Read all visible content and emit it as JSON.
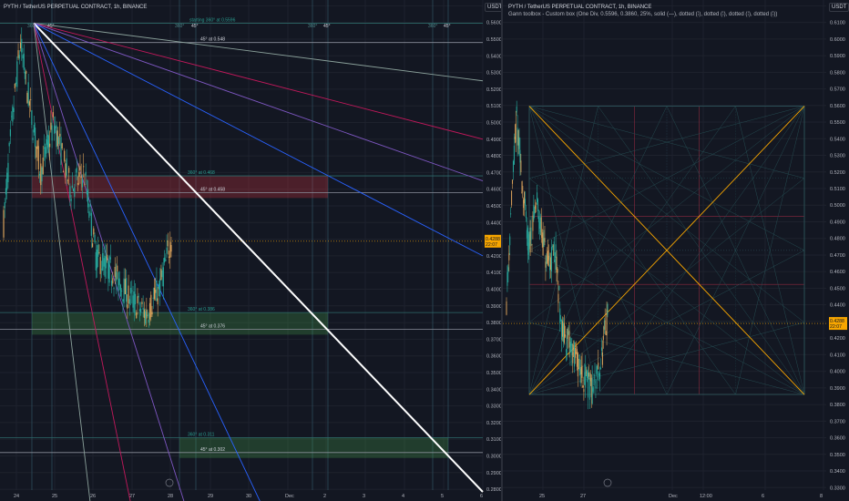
{
  "left": {
    "title": "PYTH / TetherUS PERPETUAL CONTRACT, 1h, BINANCE",
    "currency": "USDT",
    "price_axis": [
      "0.5700",
      "0.5600",
      "0.5500",
      "0.5400",
      "0.5300",
      "0.5200",
      "0.5100",
      "0.5000",
      "0.4900",
      "0.4800",
      "0.4700",
      "0.4600",
      "0.4500",
      "0.4400",
      "0.4300",
      "0.4200",
      "0.4100",
      "0.4000",
      "0.3900",
      "0.3800",
      "0.3700",
      "0.3600",
      "0.3500",
      "0.3400",
      "0.3300",
      "0.3200",
      "0.3100",
      "0.3000",
      "0.2900",
      "0.2800"
    ],
    "time_axis": [
      "24",
      "25",
      "26",
      "27",
      "28",
      "29",
      "30",
      "Dec",
      "2",
      "3",
      "4",
      "5",
      "6"
    ],
    "current_price": "0.4288",
    "countdown": "22:07",
    "angle_top_labels": [
      "360°",
      "45°",
      "360°",
      "45°",
      "360°",
      "45°",
      "360°",
      "45°"
    ],
    "annotations": {
      "starting": "starting 360° at 0.5596",
      "l1": "45° at 0.548",
      "l2_top": "360° at 0.468",
      "l2": "45° at 0.458",
      "l3_top": "360° at 0.386",
      "l3": "45° at 0.376",
      "l4_top": "360° at 0.311",
      "l4": "45° at 0.302"
    }
  },
  "right": {
    "title": "PYTH / TetherUS PERPETUAL CONTRACT, 1h, BINANCE",
    "subtitle": "Gann toolbox - Custom box (One Div, 0.5596, 0.3860, 25%, solid (—), dotted (⁞), dotted (⁞), dotted (⁞), dotted (⁞))",
    "currency": "USDT",
    "price_axis": [
      "0.6200",
      "0.6100",
      "0.6000",
      "0.5900",
      "0.5800",
      "0.5700",
      "0.5600",
      "0.5500",
      "0.5400",
      "0.5300",
      "0.5200",
      "0.5100",
      "0.5000",
      "0.4900",
      "0.4800",
      "0.4700",
      "0.4600",
      "0.4500",
      "0.4400",
      "0.4300",
      "0.4200",
      "0.4100",
      "0.4000",
      "0.3900",
      "0.3800",
      "0.3700",
      "0.3600",
      "0.3500",
      "0.3400",
      "0.3300"
    ],
    "time_axis": [
      "25",
      "27",
      "Dec",
      "12:00",
      "6",
      "8"
    ],
    "current_price": "0.4288",
    "countdown": "22:07"
  },
  "colors": {
    "background": "#131722",
    "up_candle": "#d9a15a",
    "down_candle": "#26a69a",
    "grid": "#1e222d",
    "red_zone": "#f23645",
    "green_zone": "#4caf50",
    "price_tag": "#f7a600"
  }
}
